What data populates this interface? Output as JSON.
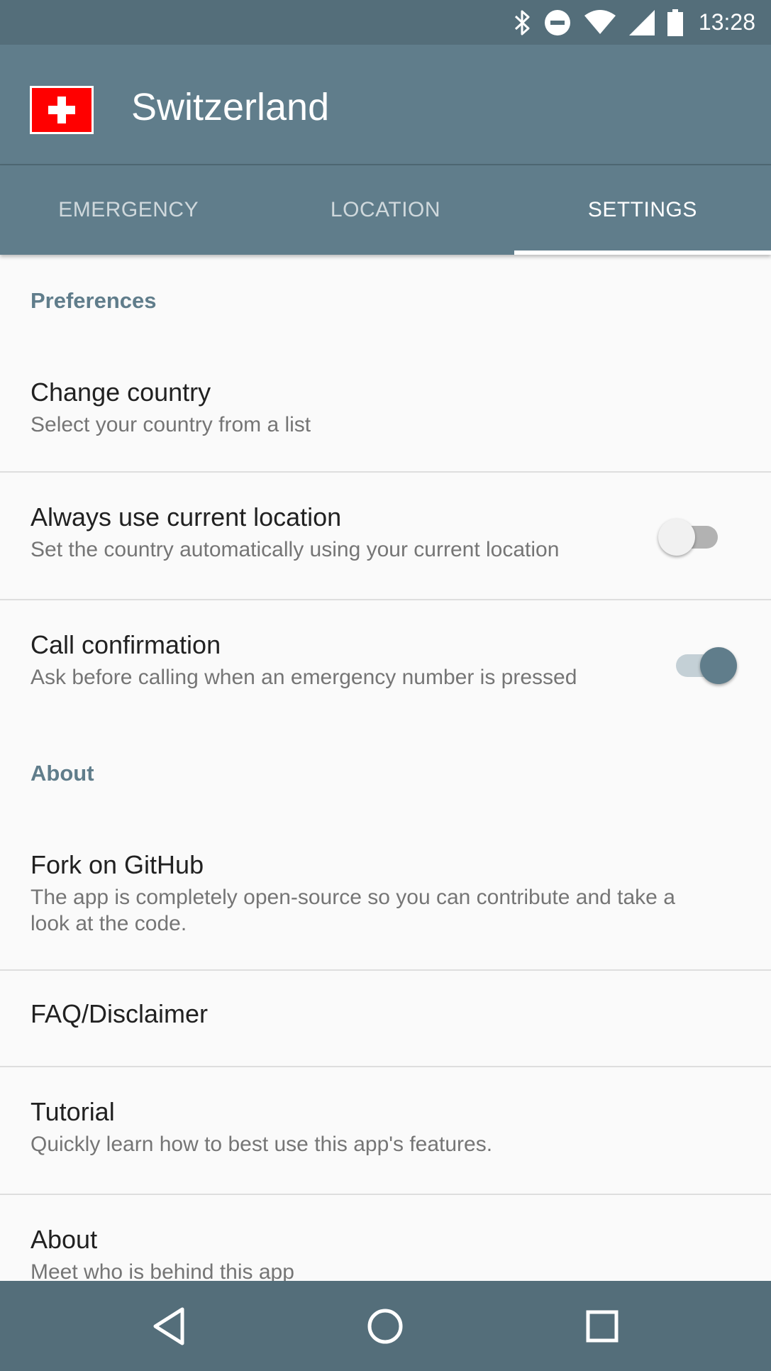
{
  "status_bar": {
    "time": "13:28",
    "icons": [
      "bluetooth-icon",
      "do-not-disturb-icon",
      "wifi-icon",
      "cell-signal-icon",
      "battery-icon"
    ]
  },
  "app_bar": {
    "title": "Switzerland",
    "flag": "switzerland-flag"
  },
  "tabs": [
    {
      "label": "EMERGENCY",
      "active": false
    },
    {
      "label": "LOCATION",
      "active": false
    },
    {
      "label": "SETTINGS",
      "active": true
    }
  ],
  "sections": {
    "preferences": {
      "header": "Preferences",
      "items": [
        {
          "title": "Change country",
          "summary": "Select your country from a list"
        },
        {
          "title": "Always use current location",
          "summary": "Set the country automatically using your current location",
          "toggle": false
        },
        {
          "title": "Call confirmation",
          "summary": "Ask before calling when an emergency number is pressed",
          "toggle": true
        }
      ]
    },
    "about": {
      "header": "About",
      "items": [
        {
          "title": "Fork on GitHub",
          "summary": "The app is completely open-source so you can contribute and take a look at the code."
        },
        {
          "title": "FAQ/Disclaimer"
        },
        {
          "title": "Tutorial",
          "summary": "Quickly learn how to best use this app's features."
        },
        {
          "title": "About",
          "summary": "Meet who is behind this app"
        }
      ]
    }
  },
  "nav_bar": {
    "buttons": [
      "back-icon",
      "home-icon",
      "recents-icon"
    ]
  },
  "colors": {
    "primary": "#607d8b",
    "primary_dark": "#546e7a",
    "background": "#fafafa"
  }
}
